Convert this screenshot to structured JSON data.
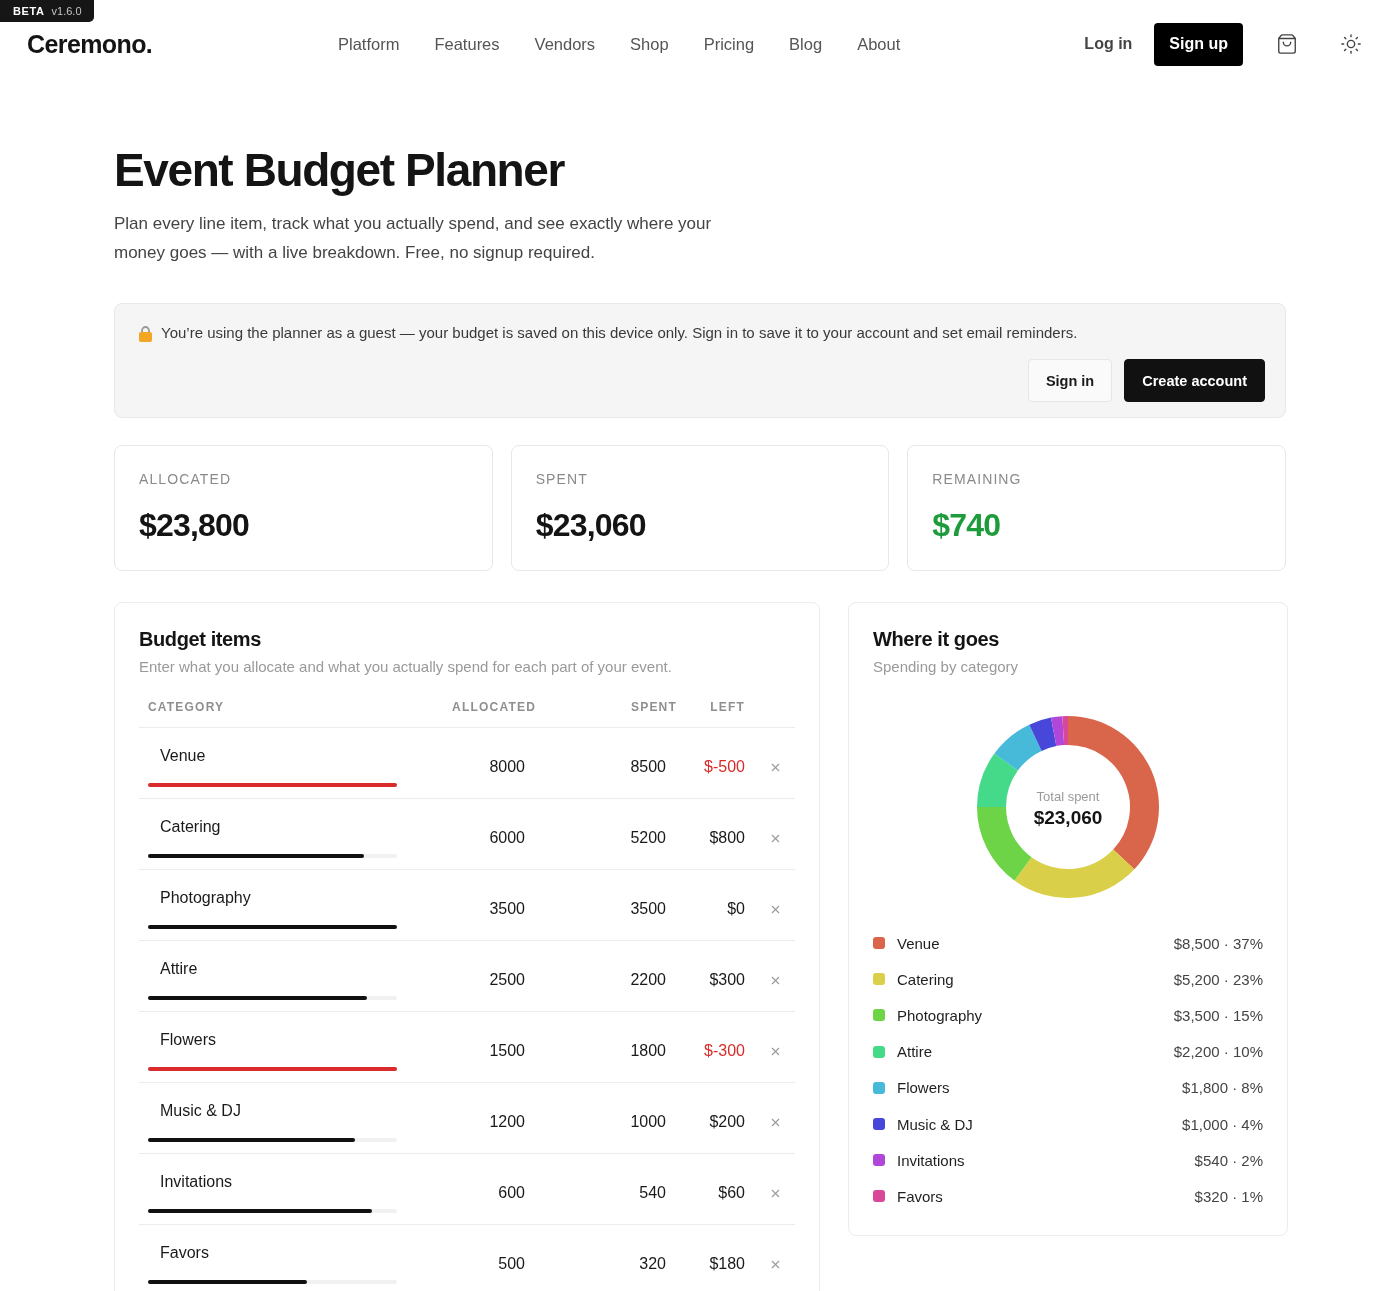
{
  "beta_badge": {
    "label": "BETA",
    "version": "v1.6.0"
  },
  "header": {
    "logo": "Ceremono.",
    "nav": [
      "Platform",
      "Features",
      "Vendors",
      "Shop",
      "Pricing",
      "Blog",
      "About"
    ],
    "login": "Log in",
    "signup": "Sign up"
  },
  "intro": {
    "title": "Event Budget Planner",
    "subtitle": "Plan every line item, track what you actually spend, and see exactly where your money goes — with a live breakdown. Free, no signup required."
  },
  "guest_banner": {
    "message": "You’re using the planner as a guest — your budget is saved on this device only. Sign in to save it to your account and set email reminders.",
    "buttons": [
      {
        "label": "Sign in",
        "kind": "secondary"
      },
      {
        "label": "Create account",
        "kind": "primary"
      }
    ]
  },
  "stats": [
    {
      "label": "ALLOCATED",
      "value": "$23,800",
      "kind": "total"
    },
    {
      "label": "SPENT",
      "value": "$23,060",
      "kind": "total"
    },
    {
      "label": "REMAINING",
      "value": "$740",
      "kind": "remaining"
    }
  ],
  "budget_items": {
    "title": "Budget items",
    "subtitle": "Enter what you allocate and what you actually spend for each part of your event.",
    "columns": [
      "CATEGORY",
      "ALLOCATED",
      "SPENT",
      "LEFT"
    ],
    "rows": [
      {
        "category": "Venue",
        "allocated": "8000",
        "spent": "8500",
        "left": "$-500",
        "over_budget": true,
        "level": 1
      },
      {
        "category": "Catering",
        "allocated": "6000",
        "spent": "5200",
        "left": "$800",
        "over_budget": false,
        "level": 0.867
      },
      {
        "category": "Photography",
        "allocated": "3500",
        "spent": "3500",
        "left": "$0",
        "over_budget": false,
        "level": 1
      },
      {
        "category": "Attire",
        "allocated": "2500",
        "spent": "2200",
        "left": "$300",
        "over_budget": false,
        "level": 0.88
      },
      {
        "category": "Flowers",
        "allocated": "1500",
        "spent": "1800",
        "left": "$-300",
        "over_budget": true,
        "level": 1
      },
      {
        "category": "Music & DJ",
        "allocated": "1200",
        "spent": "1000",
        "left": "$200",
        "over_budget": false,
        "level": 0.833
      },
      {
        "category": "Invitations",
        "allocated": "600",
        "spent": "540",
        "left": "$60",
        "over_budget": false,
        "level": 0.9
      },
      {
        "category": "Favors",
        "allocated": "500",
        "spent": "320",
        "left": "$180",
        "over_budget": false,
        "level": 0.64
      }
    ]
  },
  "breakdown": {
    "title": "Where it goes",
    "subtitle": "Spending by category",
    "center_label": "Total spent",
    "center_value": "$23,060",
    "chart_data": {
      "type": "donut",
      "categories": [
        "Venue",
        "Catering",
        "Photography",
        "Attire",
        "Flowers",
        "Music & DJ",
        "Invitations",
        "Favors"
      ],
      "values": [
        37,
        23,
        15,
        10,
        8,
        4,
        2,
        1
      ]
    },
    "legend": [
      {
        "value": "$8,500 · 37%",
        "color": "#d9654a"
      },
      {
        "value": "$5,200 · 23%",
        "color": "#d9cf48"
      },
      {
        "value": "$3,500 · 15%",
        "color": "#6dd448"
      },
      {
        "value": "$2,200 · 10%",
        "color": "#45d98a"
      },
      {
        "value": "$1,800 · 8%",
        "color": "#47b9d9"
      },
      {
        "value": "$1,000 · 4%",
        "color": "#4747d9"
      },
      {
        "value": "$540 · 2%",
        "color": "#b047d9"
      },
      {
        "value": "$320 · 1%",
        "color": "#d9479a"
      }
    ]
  }
}
